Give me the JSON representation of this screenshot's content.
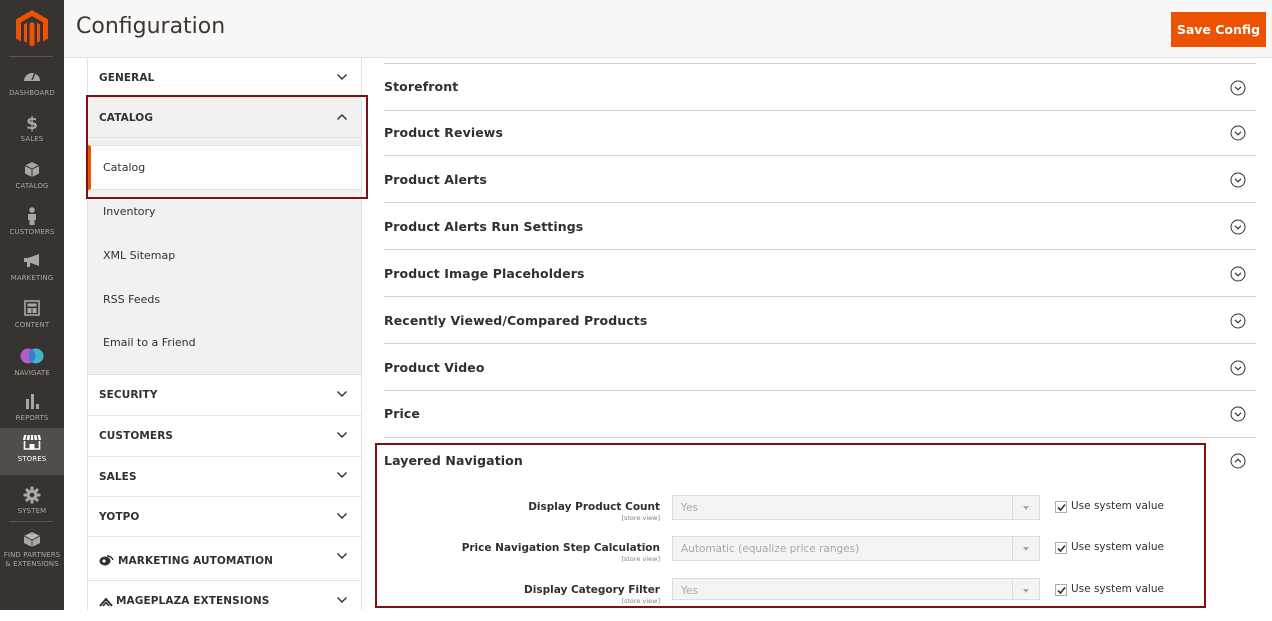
{
  "admin_nav": {
    "items": [
      {
        "label": "DASHBOARD",
        "icon": "dashboard-icon"
      },
      {
        "label": "SALES",
        "icon": "dollar-icon"
      },
      {
        "label": "CATALOG",
        "icon": "box-icon"
      },
      {
        "label": "CUSTOMERS",
        "icon": "person-icon"
      },
      {
        "label": "MARKETING",
        "icon": "megaphone-icon"
      },
      {
        "label": "CONTENT",
        "icon": "layout-icon"
      },
      {
        "label": "NAVIGATE",
        "icon": "navigate-circles-icon"
      },
      {
        "label": "REPORTS",
        "icon": "bar-chart-icon"
      },
      {
        "label": "STORES",
        "icon": "storefront-icon",
        "active": true
      },
      {
        "label": "SYSTEM",
        "icon": "gear-icon"
      },
      {
        "label": "FIND PARTNERS & EXTENSIONS",
        "label_line1": "FIND PARTNERS",
        "label_line2": "& EXTENSIONS",
        "icon": "lego-brick-icon"
      }
    ]
  },
  "header": {
    "title": "Configuration",
    "save_label": "Save Config"
  },
  "config_tabs": [
    {
      "label": "GENERAL",
      "expanded": false
    },
    {
      "label": "CATALOG",
      "expanded": true,
      "children": [
        {
          "label": "Catalog",
          "active": true
        },
        {
          "label": "Inventory"
        },
        {
          "label": "XML Sitemap"
        },
        {
          "label": "RSS Feeds"
        },
        {
          "label": "Email to a Friend"
        }
      ]
    },
    {
      "label": "SECURITY",
      "expanded": false
    },
    {
      "label": "CUSTOMERS",
      "expanded": false
    },
    {
      "label": "SALES",
      "expanded": false
    },
    {
      "label": "YOTPO",
      "expanded": false
    },
    {
      "label": "MARKETING AUTOMATION",
      "expanded": false,
      "icon": "marketing-automation-icon"
    },
    {
      "label": "MAGEPLAZA EXTENSIONS",
      "expanded": false,
      "icon": "mageplaza-icon"
    }
  ],
  "sections": [
    {
      "label": "Storefront",
      "expanded": false
    },
    {
      "label": "Product Reviews",
      "expanded": false
    },
    {
      "label": "Product Alerts",
      "expanded": false
    },
    {
      "label": "Product Alerts Run Settings",
      "expanded": false
    },
    {
      "label": "Product Image Placeholders",
      "expanded": false
    },
    {
      "label": "Recently Viewed/Compared Products",
      "expanded": false
    },
    {
      "label": "Product Video",
      "expanded": false
    },
    {
      "label": "Price",
      "expanded": false
    },
    {
      "label": "Layered Navigation",
      "expanded": true
    }
  ],
  "layered_navigation": {
    "fields": [
      {
        "label": "Display Product Count",
        "scope": "[store view]",
        "value": "Yes",
        "use_system_value": true,
        "checkbox_label": "Use system value"
      },
      {
        "label": "Price Navigation Step Calculation",
        "scope": "[store view]",
        "value": "Automatic (equalize price ranges)",
        "use_system_value": true,
        "checkbox_label": "Use system value"
      },
      {
        "label": "Display Category Filter",
        "scope": "[store view]",
        "value": "Yes",
        "use_system_value": true,
        "checkbox_label": "Use system value"
      }
    ]
  },
  "colors": {
    "accent": "#eb5202",
    "nav_bg": "#373330",
    "highlight_border": "#7d1010"
  }
}
